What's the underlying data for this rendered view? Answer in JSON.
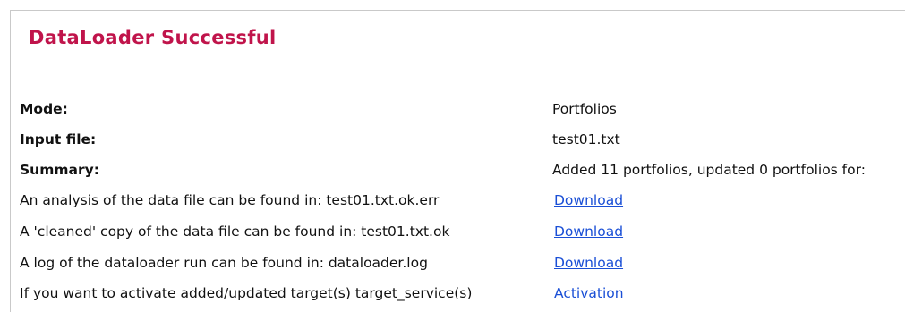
{
  "title": "DataLoader Successful",
  "details": {
    "mode_label": "Mode:",
    "mode_value": "Portfolios",
    "input_file_label": "Input file:",
    "input_file_value": "test01.txt",
    "summary_label": "Summary:",
    "summary_value": "Added 11 portfolios, updated 0 portfolios for:"
  },
  "files": {
    "analysis_text": "An analysis of the data file can be found in: test01.txt.ok.err",
    "analysis_link": "Download",
    "cleaned_text": "A 'cleaned' copy of the data file can be found in: test01.txt.ok",
    "cleaned_link": "Download",
    "log_text": "A log of the dataloader run can be found in: dataloader.log",
    "log_link": "Download",
    "activate_text": "If you want to activate added/updated target(s) target_service(s)",
    "activate_link": "Activation"
  },
  "colors": {
    "title": "#c0144b",
    "link": "#1a4fd6"
  }
}
